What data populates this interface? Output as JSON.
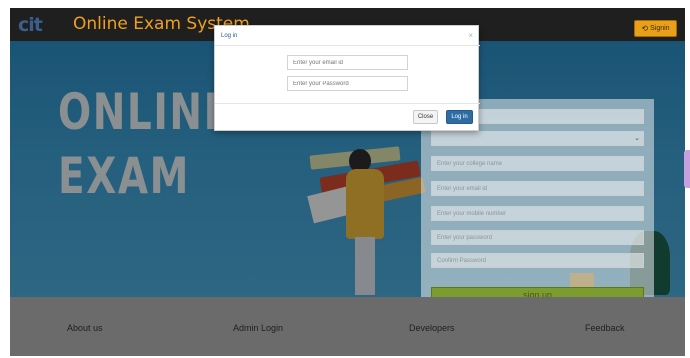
{
  "header": {
    "logo": "cit",
    "title": "Online Exam System",
    "signin_label": "Signin",
    "signin_icon": "sign-in-icon"
  },
  "hero": {
    "line1": "ONLINE",
    "line2": "EXAM"
  },
  "signup": {
    "fields": [
      {
        "placeholder": "Enter your college name"
      },
      {
        "placeholder": "Enter your email id"
      },
      {
        "placeholder": "Enter your mobile number"
      },
      {
        "placeholder": "Enter your password"
      },
      {
        "placeholder": "Confirm Password"
      }
    ],
    "button_label": "sign up"
  },
  "footer": {
    "links": [
      "About us",
      "Admin Login",
      "Developers",
      "Feedback"
    ]
  },
  "modal": {
    "title": "Log in",
    "close_icon": "×",
    "email_placeholder": "Enter your email id",
    "password_placeholder": "Enter your Password",
    "close_label": "Close",
    "login_label": "Log in"
  },
  "colors": {
    "accent": "#e6a019",
    "title": "#f0a020",
    "primary_button": "#2e6da4",
    "signup_button": "#7c9c2f"
  }
}
